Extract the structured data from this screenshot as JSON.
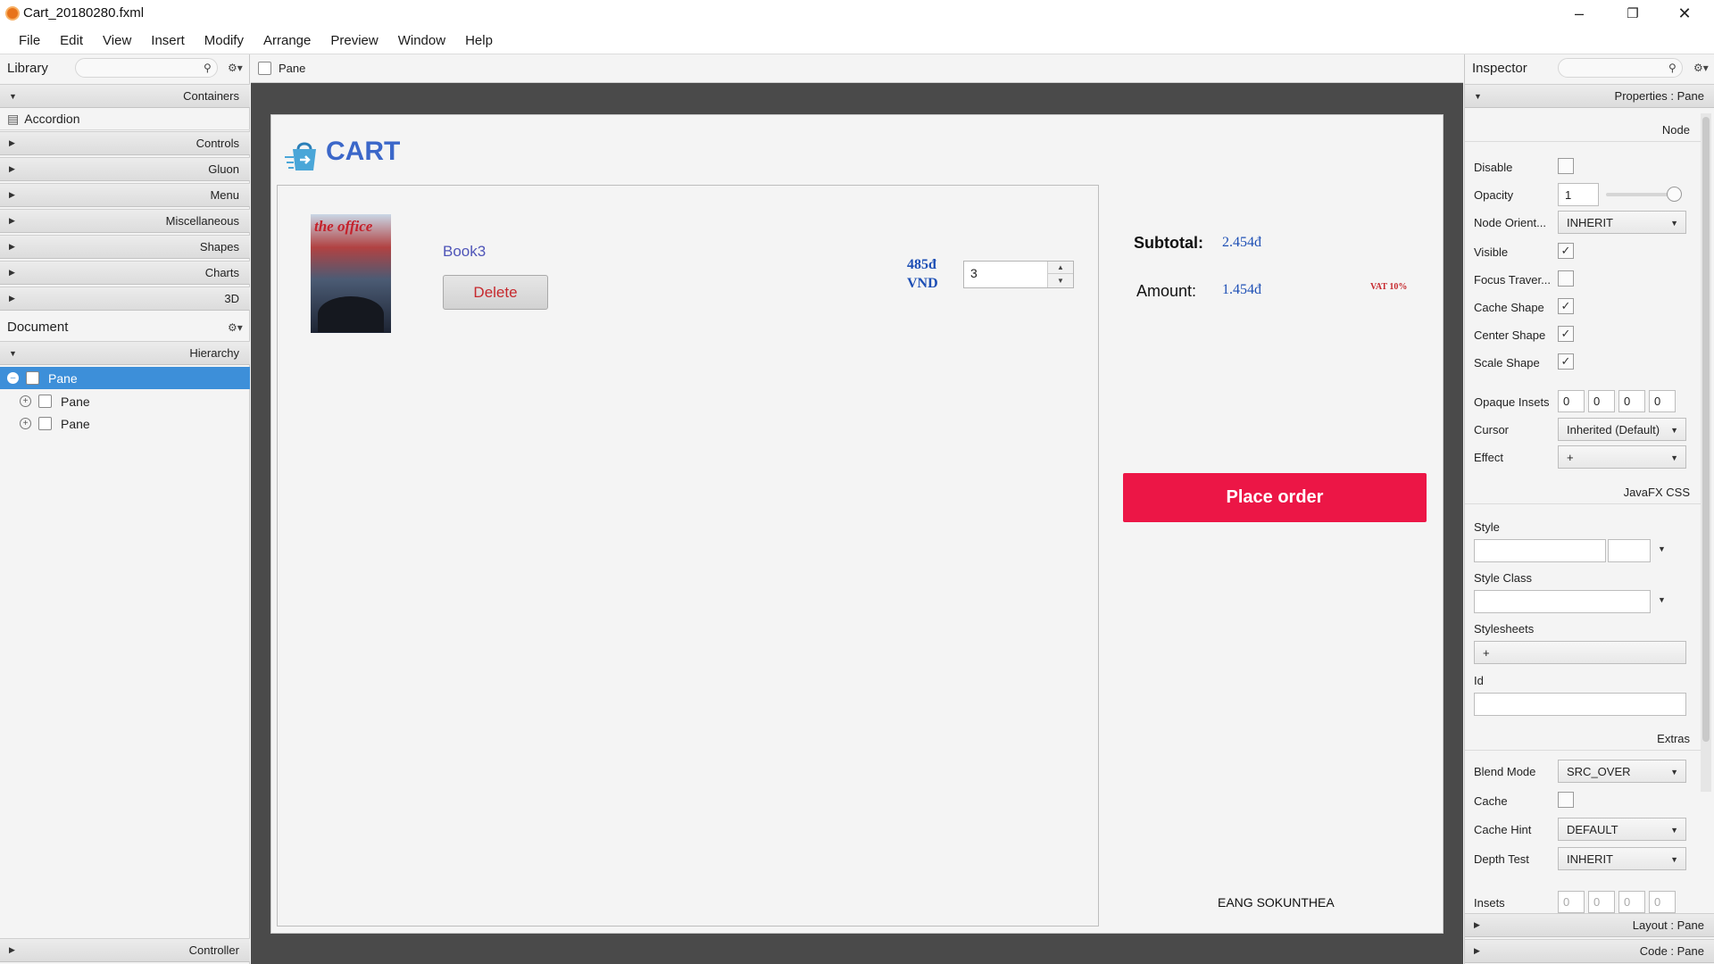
{
  "window": {
    "title": "Cart_20180280.fxml"
  },
  "menu": [
    "File",
    "Edit",
    "View",
    "Insert",
    "Modify",
    "Arrange",
    "Preview",
    "Window",
    "Help"
  ],
  "library": {
    "title": "Library",
    "sections": [
      "Containers",
      "Controls",
      "Gluon",
      "Menu",
      "Miscellaneous",
      "Shapes",
      "Charts",
      "3D"
    ],
    "expanded_item": "Accordion"
  },
  "document": {
    "title": "Document",
    "hierarchy_label": "Hierarchy",
    "tree": [
      "Pane",
      "Pane",
      "Pane"
    ],
    "controller_label": "Controller"
  },
  "canvas": {
    "breadcrumb": "Pane",
    "cart_title": "CART",
    "book_brand": "the office",
    "book_name": "Book3",
    "delete_label": "Delete",
    "price_line1": "485đ",
    "price_line2": "VND",
    "quantity": "3",
    "subtotal_label": "Subtotal:",
    "subtotal_value": "2.454đ",
    "amount_label": "Amount:",
    "amount_value": "1.454đ",
    "vat_label": "VAT 10%",
    "order_label": "Place order",
    "author": "EANG SOKUNTHEA"
  },
  "inspector": {
    "title": "Inspector",
    "properties_label": "Properties : Pane",
    "node_label": "Node",
    "disable": "Disable",
    "opacity": "Opacity",
    "opacity_value": "1",
    "node_orient": "Node Orient...",
    "node_orient_value": "INHERIT",
    "visible": "Visible",
    "focus_traversable": "Focus Traver...",
    "cache_shape": "Cache Shape",
    "center_shape": "Center Shape",
    "scale_shape": "Scale Shape",
    "opaque_insets": "Opaque Insets",
    "opaque_values": [
      "0",
      "0",
      "0",
      "0"
    ],
    "cursor": "Cursor",
    "cursor_value": "Inherited (Default)",
    "effect": "Effect",
    "effect_value": "+",
    "javafx_css": "JavaFX CSS",
    "style": "Style",
    "style_class": "Style Class",
    "stylesheets": "Stylesheets",
    "stylesheets_add": "+",
    "id": "Id",
    "extras": "Extras",
    "blend_mode": "Blend Mode",
    "blend_mode_value": "SRC_OVER",
    "cache": "Cache",
    "cache_hint": "Cache Hint",
    "cache_hint_value": "DEFAULT",
    "depth_test": "Depth Test",
    "depth_test_value": "INHERIT",
    "insets": "Insets",
    "insets_values": [
      "0",
      "0",
      "0",
      "0"
    ],
    "layout_label": "Layout : Pane",
    "code_label": "Code : Pane"
  },
  "colors": {
    "accent": "#3b67c9",
    "order_button": "#ec1646",
    "selection": "#3d8fd9"
  }
}
